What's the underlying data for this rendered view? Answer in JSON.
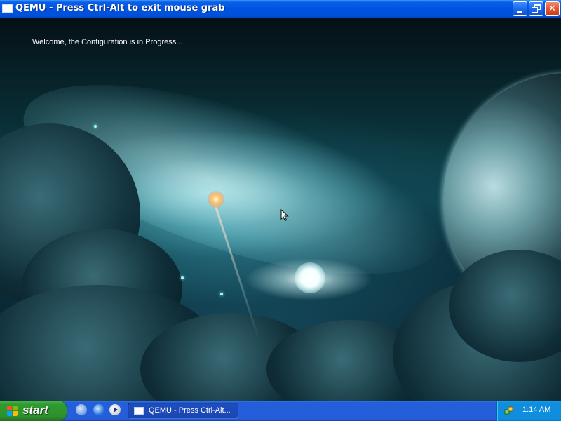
{
  "window": {
    "title": "QEMU - Press Ctrl-Alt to exit mouse grab",
    "controls": [
      "minimize",
      "restore",
      "close"
    ]
  },
  "desktop": {
    "message": "Welcome, the Configuration is in Progress..."
  },
  "taskbar": {
    "start_label": "start",
    "quick_launch": [
      "show-desktop-icon",
      "internet-explorer-icon",
      "media-player-icon"
    ],
    "tasks": [
      {
        "label": "QEMU - Press Ctrl-Alt..."
      }
    ],
    "clock": "1:14 AM"
  },
  "colors": {
    "titlebar": "#0053e1",
    "taskbar": "#245edb",
    "start_button": "#2f9b2f",
    "tray": "#0f8ee0",
    "close_button": "#e2512c"
  }
}
